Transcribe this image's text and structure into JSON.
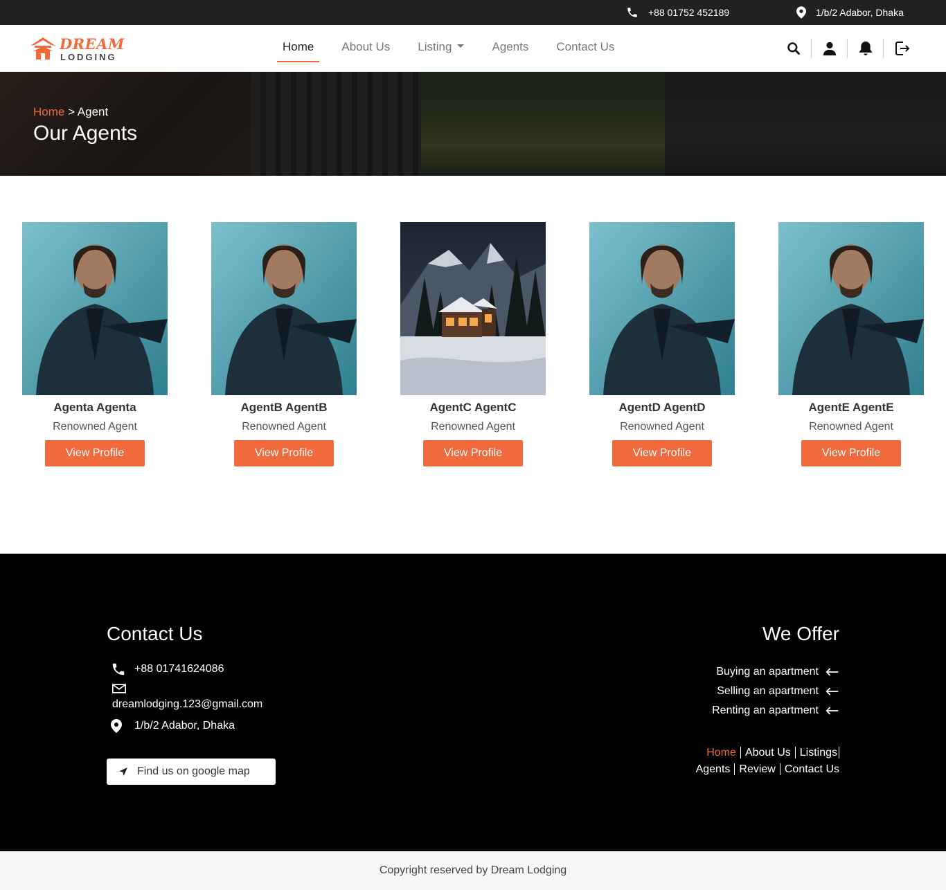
{
  "topbar": {
    "phone": "+88 01752 452189",
    "address": "1/b/2 Adabor, Dhaka"
  },
  "brand": {
    "line1": "DREAM",
    "line2": "LODGING",
    "accent": "#f06a3d"
  },
  "nav": {
    "items": [
      {
        "label": "Home"
      },
      {
        "label": "About Us"
      },
      {
        "label": "Listing"
      },
      {
        "label": "Agents"
      },
      {
        "label": "Contact Us"
      }
    ],
    "icons": [
      "search-icon",
      "user-icon",
      "bell-icon",
      "logout-icon"
    ]
  },
  "hero": {
    "crumb_home": "Home",
    "crumb_sep": " > ",
    "crumb_current": "Agent",
    "title": "Our Agents"
  },
  "agents": [
    {
      "name": "Agenta Agenta",
      "role": "Renowned Agent",
      "button": "View Profile",
      "photo": "man-in-suit-photo"
    },
    {
      "name": "AgentB AgentB",
      "role": "Renowned Agent",
      "button": "View Profile",
      "photo": "man-in-suit-photo"
    },
    {
      "name": "AgentC AgentC",
      "role": "Renowned Agent",
      "button": "View Profile",
      "photo": "snowy-cabin-photo"
    },
    {
      "name": "AgentD AgentD",
      "role": "Renowned Agent",
      "button": "View Profile",
      "photo": "man-in-suit-photo"
    },
    {
      "name": "AgentE AgentE",
      "role": "Renowned Agent",
      "button": "View Profile",
      "photo": "man-in-suit-photo"
    }
  ],
  "footer": {
    "contact_title": "Contact Us",
    "phone": "+88 01741624086",
    "email": "dreamlodging.123@gmail.com",
    "address": "1/b/2 Adabor, Dhaka",
    "map_button": "Find us on google map",
    "offer_title": "We Offer",
    "offers": [
      "Buying an apartment",
      "Selling an apartment",
      "Renting an apartment"
    ],
    "links_row1": [
      "Home",
      "About Us",
      "Listings"
    ],
    "links_row2": [
      "Agents",
      "Review",
      "Contact Us"
    ]
  },
  "copyright": "Copyright reserved by Dream Lodging"
}
